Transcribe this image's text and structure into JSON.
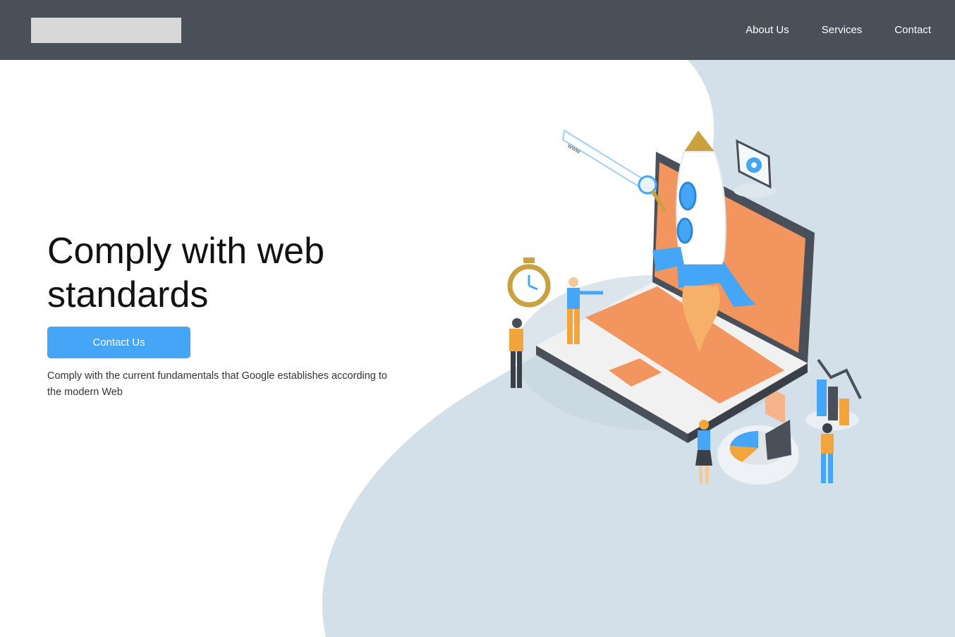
{
  "nav": {
    "links": [
      {
        "label": "About Us"
      },
      {
        "label": "Services"
      },
      {
        "label": "Contact"
      }
    ]
  },
  "hero": {
    "title_line1": "Comply with web",
    "title_line2": "standards",
    "cta_label": "Contact Us",
    "description": "Comply with the current fundamentals that Google establishes according to the modern Web"
  },
  "illustration": {
    "search_bar_text": "www",
    "icons": [
      "rocket-icon",
      "laptop-icon",
      "gear-icon",
      "magnifier-icon",
      "stopwatch-icon",
      "bar-chart-icon",
      "pie-chart-icon"
    ]
  },
  "colors": {
    "navbar": "#4a5059",
    "accent": "#45a5f7",
    "background_shape": "#d3e0e9",
    "illustration_orange": "#f2955e"
  }
}
